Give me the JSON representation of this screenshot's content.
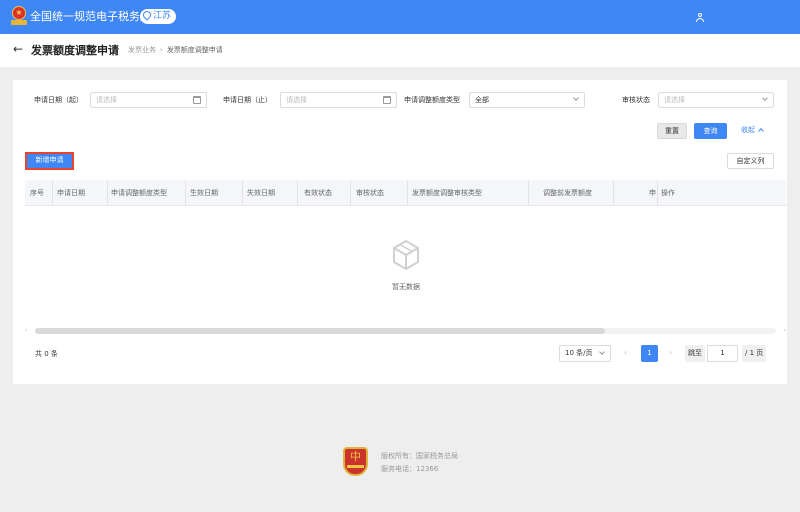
{
  "topbar": {
    "site_title": "全国统一规范电子税务局",
    "region": "江苏",
    "brand_color": "#3f87f5"
  },
  "header": {
    "page_title": "发票额度调整申请",
    "breadcrumb": [
      "发票业务",
      "发票额度调整申请"
    ]
  },
  "filters": {
    "start_date_label": "申请日期（起）",
    "start_date_placeholder": "请选择",
    "end_date_label": "申请日期（止）",
    "end_date_placeholder": "请选择",
    "adjust_type_label": "申请调整额度类型",
    "adjust_type_value": "全部",
    "review_status_label": "审核状态",
    "review_status_placeholder": "请选择"
  },
  "actions": {
    "reset_label": "重置",
    "query_label": "查询",
    "collapse_label": "收起",
    "add_label": "新增申请",
    "custom_columns_label": "自定义列"
  },
  "table": {
    "columns": [
      "序号",
      "申请日期",
      "申请调整额度类型",
      "生效日期",
      "失效日期",
      "有效状态",
      "审核状态",
      "发票额度调整审核类型",
      "调整前发票额度",
      "申",
      "操作"
    ],
    "rows": [],
    "empty_text": "暂无数据"
  },
  "pagination": {
    "total_text": "共 0 条",
    "page_size": "10 条/页",
    "current_page": "1",
    "jump_label": "跳至",
    "jump_value": "1",
    "page_count_text": "/ 1 页"
  },
  "footer": {
    "copyright": "版权所有：国家税务总局",
    "hotline": "服务电话：12366"
  },
  "icons": [
    "emblem-icon",
    "location-pin-icon",
    "user-icon",
    "back-arrow-icon",
    "calendar-icon",
    "chevron-down-icon",
    "chevron-up-icon",
    "empty-box-icon",
    "chevron-left-icon",
    "chevron-right-icon",
    "tax-bureau-logo-icon"
  ]
}
